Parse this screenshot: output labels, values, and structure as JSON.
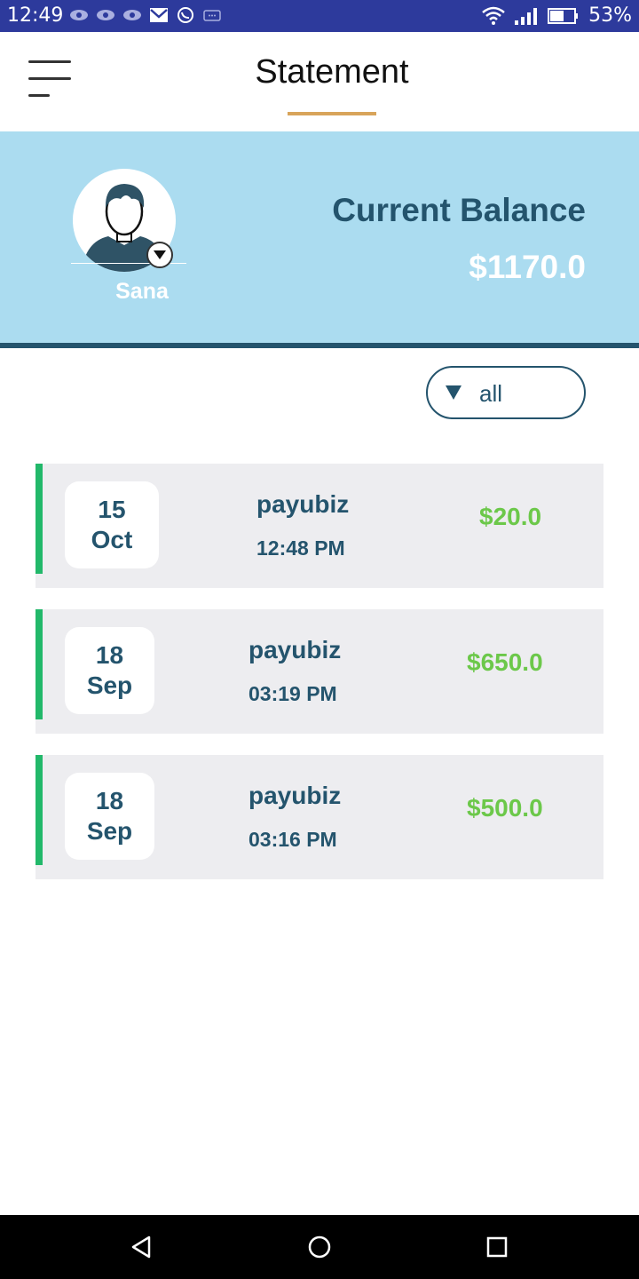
{
  "status_bar": {
    "time": "12:49",
    "battery": "53%",
    "background": "#2d3a9c"
  },
  "header": {
    "title": "Statement",
    "menu_icon": "hamburger-menu-icon",
    "accent_color": "#d8a45a"
  },
  "balance": {
    "user_name": "Sana",
    "label": "Current Balance",
    "value": "$1170.0",
    "panel_color": "#abdcf0",
    "text_color": "#24546d"
  },
  "filter": {
    "selected": "all"
  },
  "transactions": [
    {
      "day": "15",
      "month": "Oct",
      "name": "payubiz",
      "time": "12:48 PM",
      "amount": "$20.0"
    },
    {
      "day": "18",
      "month": "Sep",
      "name": "payubiz",
      "time": "03:19 PM",
      "amount": "$650.0"
    },
    {
      "day": "18",
      "month": "Sep",
      "name": "payubiz",
      "time": "03:16 PM",
      "amount": "$500.0"
    }
  ],
  "colors": {
    "accent_green": "#22b86a",
    "amount_green": "#6cc84a",
    "card_bg": "#ededf0"
  },
  "nav_bar": {
    "back_icon": "back-triangle-icon",
    "home_icon": "home-circle-icon",
    "recents_icon": "recents-square-icon"
  }
}
